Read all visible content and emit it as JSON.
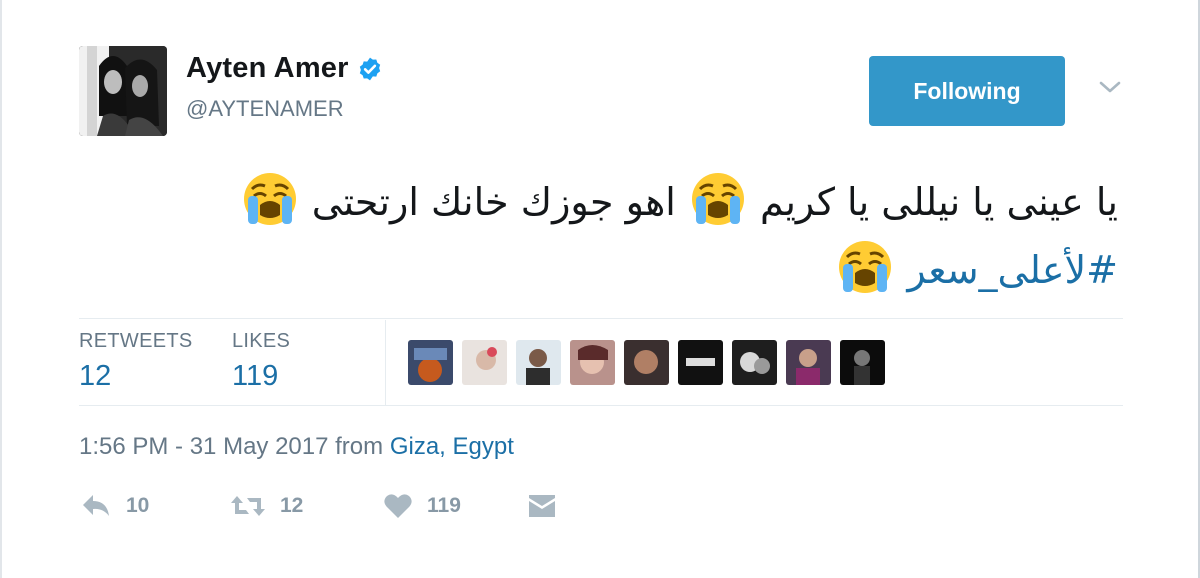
{
  "user": {
    "name": "Ayten Amer",
    "handle": "@AYTENAMER",
    "verified": true
  },
  "follow_button": {
    "label": "Following"
  },
  "tweet": {
    "line1_part1": "يا عينى يا نيللى يا كريم",
    "line1_part2": "اهو جوزك خانك ارتحتى",
    "hashtag": "#لأعلى_سعر",
    "emoji": "loudly-crying-face-emoji"
  },
  "stats": {
    "retweets_label": "RETWEETS",
    "retweets_value": "12",
    "likes_label": "LIKES",
    "likes_value": "119"
  },
  "meta": {
    "timestamp": "1:56 PM - 31 May 2017",
    "from": "from",
    "place_city": "Giza",
    "comma": ",",
    "place_country": "Egypt"
  },
  "actions": {
    "reply_count": "10",
    "retweet_count": "12",
    "like_count": "119"
  },
  "colors": {
    "accent": "#1b6fa6",
    "button": "#3397c9",
    "muted": "#657786",
    "action_gray": "#8899a6"
  }
}
